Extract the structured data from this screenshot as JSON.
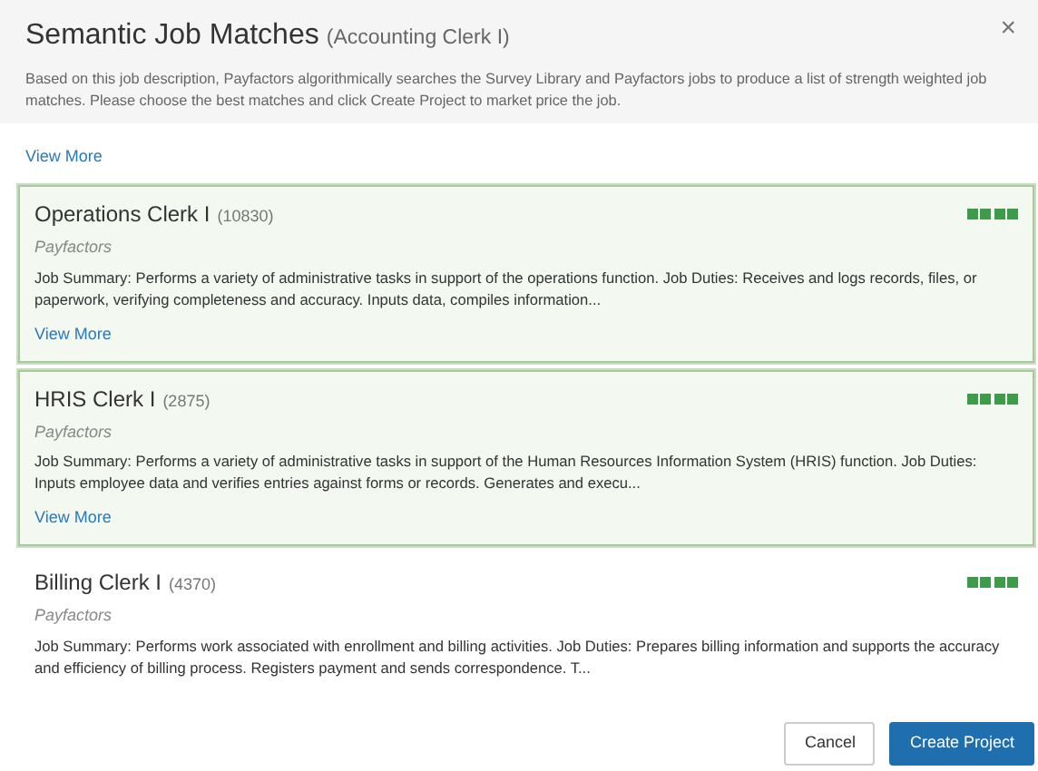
{
  "header": {
    "title": "Semantic Job Matches",
    "subtitle": "(Accounting Clerk I)",
    "close": "×",
    "description": "Based on this job description, Payfactors algorithmically searches the Survey Library and Payfactors jobs to produce a list of strength weighted job matches. Please choose the best matches and click Create Project to market price the job."
  },
  "top_link": "View More",
  "matches": [
    {
      "title": "Operations Clerk I",
      "count": "(10830)",
      "source": "Payfactors",
      "summary": "Job Summary: Performs a variety of administrative tasks in support of the operations function. Job Duties: Receives and logs records, files, or paperwork, verifying completeness and accuracy. Inputs data, compiles information...",
      "link": "View More",
      "selected": true,
      "stars": 4
    },
    {
      "title": "HRIS Clerk I",
      "count": "(2875)",
      "source": "Payfactors",
      "summary": "Job Summary: Performs a variety of administrative tasks in support of the Human Resources Information System (HRIS) function. Job Duties: Inputs employee data and verifies entries against forms or records. Generates and execu...",
      "link": "View More",
      "selected": true,
      "stars": 4
    },
    {
      "title": "Billing Clerk I",
      "count": "(4370)",
      "source": "Payfactors",
      "summary": "Job Summary: Performs work associated with enrollment and billing activities. Job Duties: Prepares billing information and supports the accuracy and efficiency of billing process. Registers payment and sends correspondence. T...",
      "selected": false,
      "stars": 4
    }
  ],
  "buttons": [
    {
      "label": "Cancel",
      "kind": "secondary"
    },
    {
      "label": "Create Project",
      "kind": "primary"
    }
  ]
}
